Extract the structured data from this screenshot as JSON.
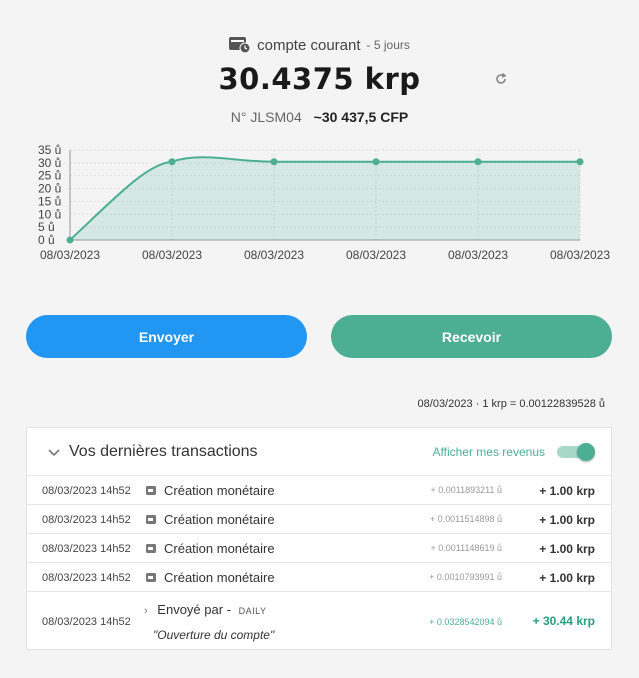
{
  "account": {
    "name": "compte courant",
    "days": "- 5 jours",
    "balance": "30.4375 krp",
    "number": "N° JLSM04",
    "cfp": "~30 437,5 CFP"
  },
  "chart_data": {
    "type": "area",
    "title": "",
    "xlabel": "",
    "ylabel": "",
    "x": [
      "08/03/2023",
      "08/03/2023",
      "08/03/2023",
      "08/03/2023",
      "08/03/2023",
      "08/03/2023"
    ],
    "series": [
      {
        "values": [
          0,
          30.44,
          30.44,
          30.44,
          30.44,
          30.44
        ]
      }
    ],
    "ylim": [
      0,
      35
    ],
    "yticks": [
      "0 ů",
      "5 ů",
      "10 ů",
      "15 ů",
      "20 ů",
      "25 ů",
      "30 ů",
      "35 ů"
    ],
    "grid": true,
    "color": "#4caf93"
  },
  "actions": {
    "send": "Envoyer",
    "receive": "Recevoir"
  },
  "rate": "08/03/2023 · 1 krp = 0.00122839528 ů",
  "transactions": {
    "title": "Vos dernières transactions",
    "toggle_label": "Afficher mes revenus",
    "toggle_on": true,
    "rows": [
      {
        "date": "08/03/2023 14h52",
        "label": "Création monétaire",
        "fine": "+ 0.0011893211 ů",
        "amount": "+ 1.00 krp"
      },
      {
        "date": "08/03/2023 14h52",
        "label": "Création monétaire",
        "fine": "+ 0.0011514898 ů",
        "amount": "+ 1.00 krp"
      },
      {
        "date": "08/03/2023 14h52",
        "label": "Création monétaire",
        "fine": "+ 0.0011148619 ů",
        "amount": "+ 1.00 krp"
      },
      {
        "date": "08/03/2023 14h52",
        "label": "Création monétaire",
        "fine": "+ 0.0010793991 ů",
        "amount": "+ 1.00 krp"
      }
    ],
    "last": {
      "date": "08/03/2023 14h52",
      "sent_label": "Envoyé par -",
      "sender": "DAILY",
      "note": "\"Ouverture du compte\"",
      "fine": "+ 0.0328542094 ů",
      "amount": "+ 30.44 krp"
    }
  },
  "colors": {
    "accent_blue": "#2196f3",
    "accent_green": "#4caf93"
  },
  "icons": [
    "wallet-clock-icon",
    "refresh-icon",
    "chevron-down-icon",
    "wallet-icon",
    "chevron-right-icon"
  ]
}
